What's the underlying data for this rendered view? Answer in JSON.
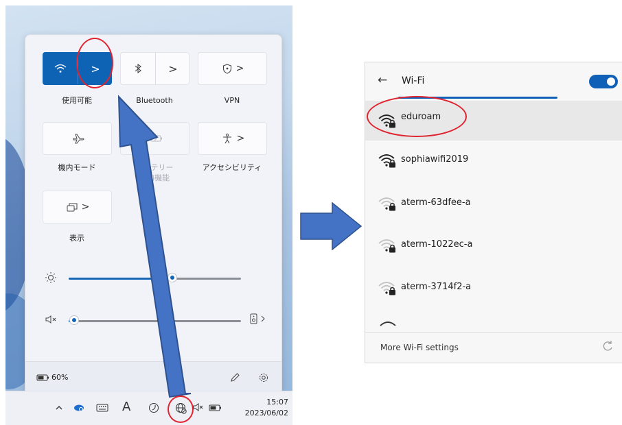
{
  "quick_settings": {
    "tiles": [
      {
        "label": "使用可能",
        "state": "on",
        "icon": "wifi-icon",
        "has_chevron": true
      },
      {
        "label": "Bluetooth",
        "state": "off",
        "icon": "bluetooth-icon",
        "has_chevron": true
      },
      {
        "label": "VPN",
        "state": "off",
        "icon": "shield-icon",
        "has_chevron": true
      },
      {
        "label": "機内モード",
        "state": "off",
        "icon": "airplane-icon",
        "has_chevron": false
      },
      {
        "label_line1": "バッテリー",
        "label_line2": "節約機能",
        "state": "disabled",
        "icon": "battery-saver-icon",
        "has_chevron": false
      },
      {
        "label": "アクセシビリティ",
        "state": "off",
        "icon": "accessibility-icon",
        "has_chevron": true
      },
      {
        "label": "表示",
        "state": "off",
        "icon": "cast-icon",
        "has_chevron": true
      }
    ],
    "brightness_level": 0.6,
    "volume_level": 0.03,
    "battery_text": "60%",
    "chevron": "›",
    "chevron_alt": ">"
  },
  "taskbar": {
    "time": "15:07",
    "date": "2023/06/02",
    "input_indicator": "A"
  },
  "wifi": {
    "title": "Wi-Fi",
    "back_glyph": "←",
    "toggle_on": true,
    "networks": [
      {
        "name": "eduroam",
        "secured": true,
        "strength": "strong",
        "selected": true
      },
      {
        "name": "sophiawifi2019",
        "secured": true,
        "strength": "strong",
        "selected": false
      },
      {
        "name": "aterm-63dfee-a",
        "secured": true,
        "strength": "weak",
        "selected": false
      },
      {
        "name": "aterm-1022ec-a",
        "secured": true,
        "strength": "weak",
        "selected": false
      },
      {
        "name": "aterm-3714f2-a",
        "secured": true,
        "strength": "weak",
        "selected": false
      }
    ],
    "footer_link": "More Wi-Fi settings",
    "refresh_glyph": "C"
  },
  "colors": {
    "accent": "#0f63b4",
    "annotation_red": "#e0232e",
    "annotation_arrow": "#4472c4"
  }
}
